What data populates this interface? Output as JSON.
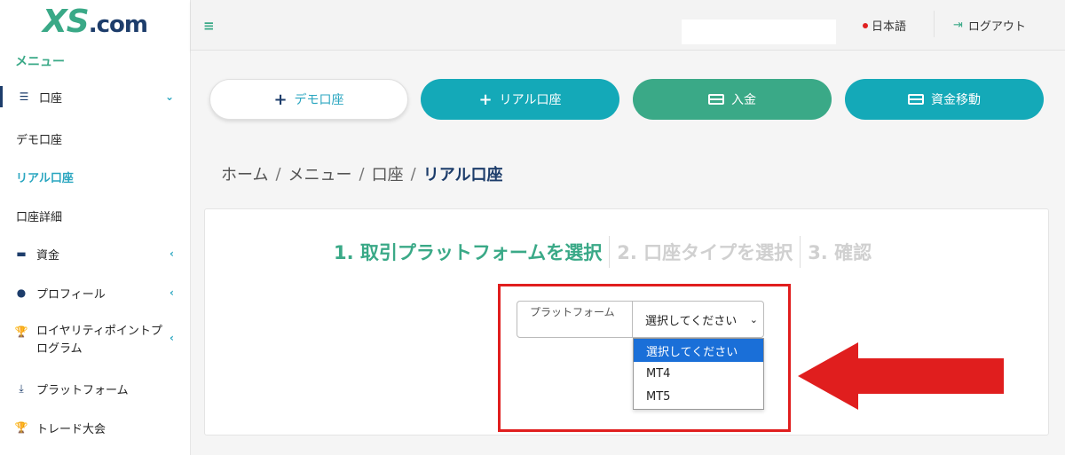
{
  "brand": {
    "logo_main": "XS",
    "logo_suffix": ".com"
  },
  "sidebar": {
    "menu_title": "メニュー",
    "accounts": {
      "label": "口座",
      "subitems": [
        "デモ口座",
        "リアル口座",
        "口座詳細"
      ]
    },
    "items": [
      {
        "label": "資金"
      },
      {
        "label": "プロフィール"
      },
      {
        "label": "ロイヤリティポイントプログラム"
      },
      {
        "label": "プラットフォーム"
      },
      {
        "label": "トレード大会"
      }
    ]
  },
  "header": {
    "language": "日本語",
    "logout": "ログアウト"
  },
  "actions": {
    "demo": "デモ口座",
    "real": "リアル口座",
    "deposit": "入金",
    "transfer": "資金移動"
  },
  "breadcrumb": [
    "ホーム",
    "メニュー",
    "口座",
    "リアル口座"
  ],
  "steps": [
    "1. 取引プラットフォームを選択",
    "2. 口座タイプを選択",
    "3. 確認"
  ],
  "form": {
    "platform_label": "プラットフォーム",
    "selected_value": "選択してください",
    "options": [
      "選択してください",
      "MT4",
      "MT5"
    ]
  },
  "colors": {
    "green": "#3aa987",
    "teal": "#14a9b8",
    "navy": "#1d3d6b",
    "highlight_red": "#e01e1e",
    "option_selected": "#1a6fd8"
  }
}
